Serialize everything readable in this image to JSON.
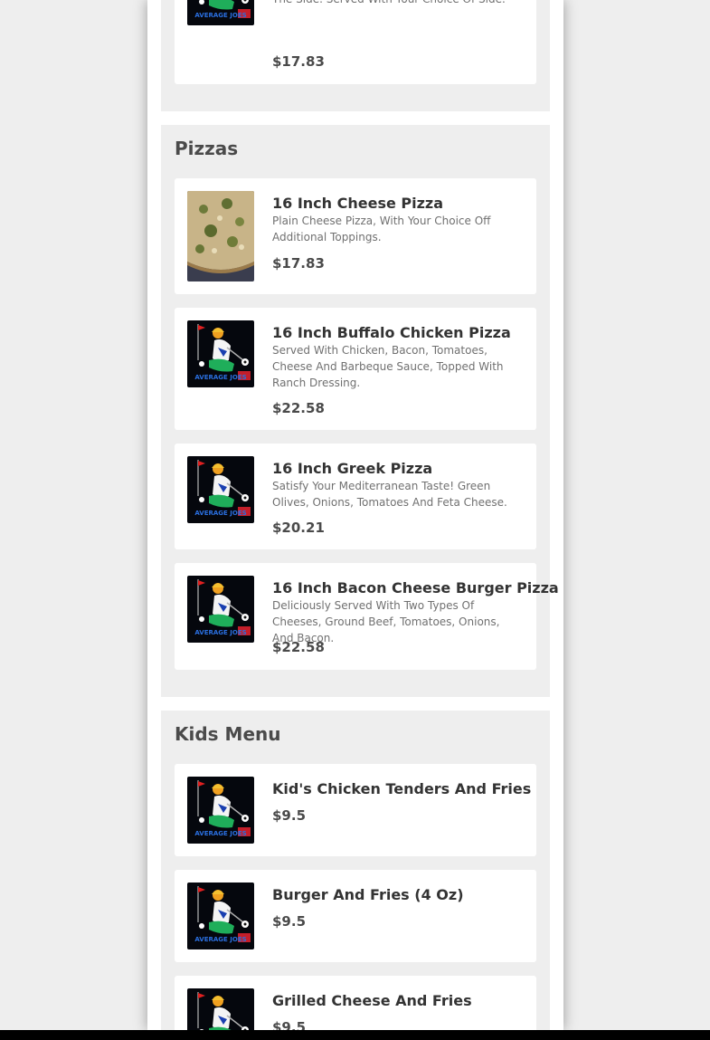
{
  "top_item": {
    "description": "Two Perch Tacos, Topped With Creamy Coleslaw, Tomatoes And Lettuce. Tartar On The Side. Served With Your Choice Of Side.",
    "price": "$17.83"
  },
  "pizzas": {
    "title": "Pizzas",
    "items": [
      {
        "name": "16 Inch Cheese Pizza",
        "description": "Plain Cheese Pizza, With Your Choice Off Additional Toppings.",
        "price": "$17.83"
      },
      {
        "name": "16 Inch Buffalo Chicken Pizza",
        "description": "Served With Chicken, Bacon, Tomatoes, Cheese And Barbeque Sauce, Topped With Ranch Dressing.",
        "price": "$22.58"
      },
      {
        "name": "16 Inch Greek Pizza",
        "description": "Satisfy Your Mediterranean Taste! Green Olives, Onions, Tomatoes And Feta Cheese.",
        "price": "$20.21"
      },
      {
        "name": "16 Inch Bacon Cheese Burger Pizza",
        "description": "Deliciously Served With Two Types Of Cheeses, Ground Beef, Tomatoes, Onions, And Bacon.",
        "price": "$22.58"
      }
    ]
  },
  "kids_menu": {
    "title": "Kids Menu",
    "items": [
      {
        "name": "Kid's Chicken Tenders And Fries",
        "price": "$9.5"
      },
      {
        "name": "Burger And Fries (4 Oz)",
        "price": "$9.5"
      },
      {
        "name": "Grilled Cheese And Fries",
        "price": "$9.5"
      }
    ]
  },
  "logo_text": "AVERAGE JOES"
}
